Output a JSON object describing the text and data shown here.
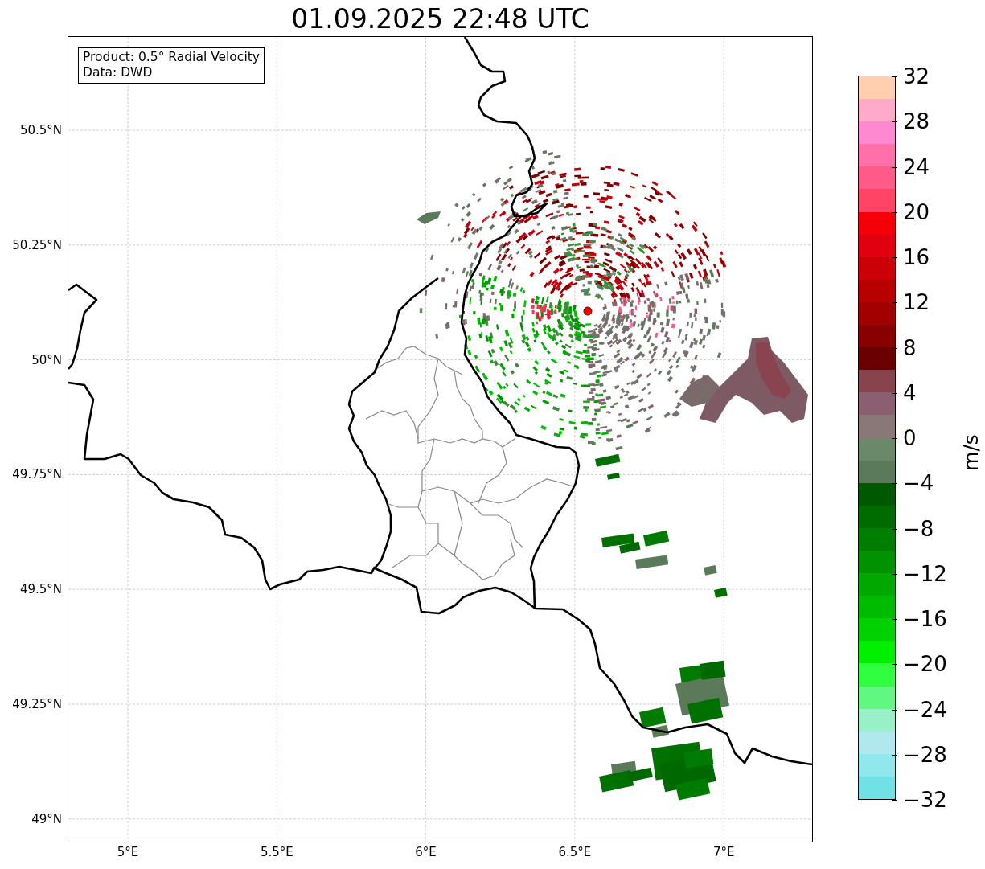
{
  "title": "01.09.2025 22:48 UTC",
  "map": {
    "legend": [
      "Product: 0.5° Radial Velocity",
      "Data: DWD"
    ],
    "lat_ticks": [
      "50.5°N",
      "50.25°N",
      "50°N",
      "49.75°N",
      "49.5°N",
      "49.25°N",
      "49°N"
    ],
    "lon_ticks": [
      "5°E",
      "5.5°E",
      "6°E",
      "6.5°E",
      "7°E"
    ]
  },
  "colorbar": {
    "label": "m/s",
    "ticks": [
      "32",
      "28",
      "24",
      "20",
      "16",
      "12",
      "8",
      "4",
      "0",
      "−4",
      "−8",
      "−12",
      "−16",
      "−20",
      "−24",
      "−28",
      "−32"
    ],
    "segments": [
      {
        "color": "#ffcfb0"
      },
      {
        "color": "#ffaac8"
      },
      {
        "color": "#ff88d0"
      },
      {
        "color": "#ff70a8"
      },
      {
        "color": "#ff5a88"
      },
      {
        "color": "#ff4466"
      },
      {
        "color": "#f50008"
      },
      {
        "color": "#e00010"
      },
      {
        "color": "#cc0008"
      },
      {
        "color": "#b80000"
      },
      {
        "color": "#a00000"
      },
      {
        "color": "#880000"
      },
      {
        "color": "#6a0000"
      },
      {
        "color": "#88444c"
      },
      {
        "color": "#8a6070"
      },
      {
        "color": "#8a7878"
      },
      {
        "color": "#6a886a"
      },
      {
        "color": "#5a7a5a"
      },
      {
        "color": "#005800"
      },
      {
        "color": "#006c00"
      },
      {
        "color": "#007e00"
      },
      {
        "color": "#009200"
      },
      {
        "color": "#00a800"
      },
      {
        "color": "#00bc00"
      },
      {
        "color": "#00d200"
      },
      {
        "color": "#00f000"
      },
      {
        "color": "#30ff40"
      },
      {
        "color": "#60f880"
      },
      {
        "color": "#98f0c8"
      },
      {
        "color": "#b0e8ee"
      },
      {
        "color": "#90e8ec"
      },
      {
        "color": "#70e2e6"
      }
    ]
  }
}
